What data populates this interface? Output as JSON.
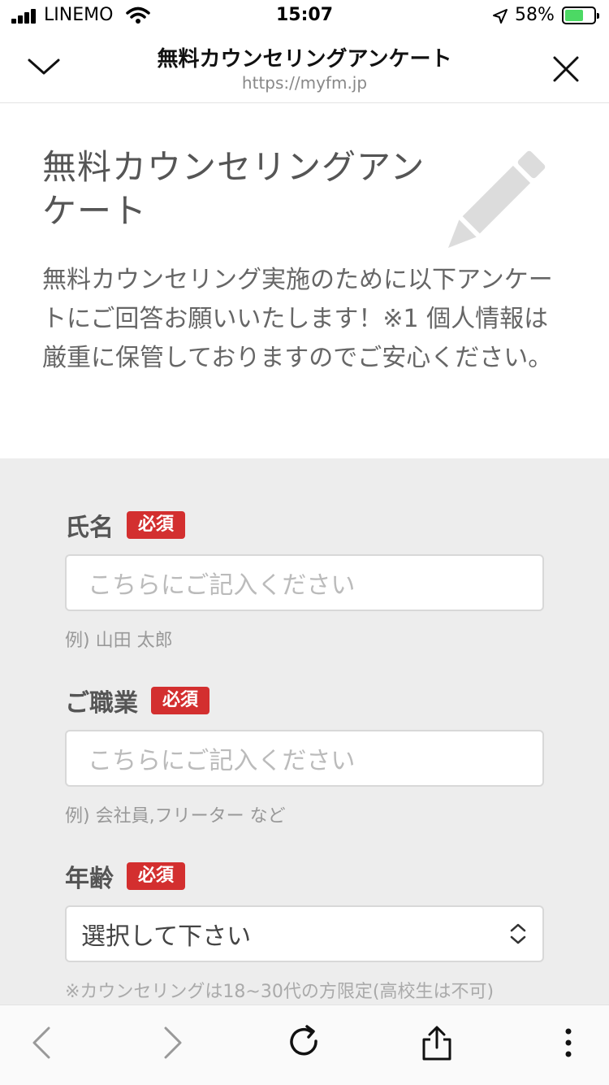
{
  "status_bar": {
    "carrier": "LINEMO",
    "time": "15:07",
    "battery": "58%"
  },
  "nav": {
    "title": "無料カウンセリングアンケート",
    "url": "https://myfm.jp"
  },
  "intro": {
    "heading": "無料カウンセリングアンケート",
    "description": "無料カウンセリング実施のために以下アンケートにご回答お願いいたします！※1 個人情報は厳重に保管しておりますのでご安心ください。"
  },
  "form": {
    "required_badge": "必須",
    "name": {
      "label": "氏名",
      "placeholder": "こちらにご記入ください",
      "hint": "例) 山田 太郎"
    },
    "occupation": {
      "label": "ご職業",
      "placeholder": "こちらにご記入ください",
      "hint": "例) 会社員,フリーター など"
    },
    "age": {
      "label": "年齢",
      "selected": "選択して下さい",
      "note": "※カウンセリングは18~30代の方限定(高校生は不可)"
    }
  },
  "colors": {
    "required_badge": "#d32f2f",
    "form_background": "#ededed",
    "battery_fill": "#4cd964"
  },
  "icons": {
    "status": [
      "signal-icon",
      "wifi-icon",
      "location-icon",
      "battery-icon"
    ],
    "nav": [
      "chevron-down-icon",
      "close-icon"
    ],
    "decor": "pencil-icon",
    "toolbar": [
      "back-icon",
      "forward-icon",
      "reload-icon",
      "share-icon",
      "more-icon"
    ]
  }
}
